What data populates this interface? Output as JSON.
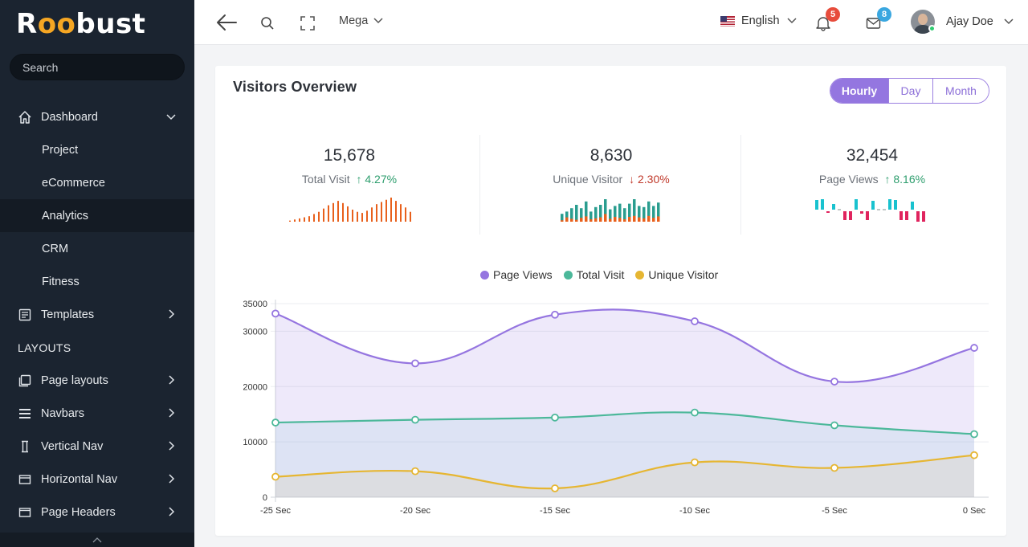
{
  "app": {
    "logo_prefix": "R",
    "logo_oo": "oo",
    "logo_suffix": "bust"
  },
  "sidebar": {
    "search_placeholder": "Search",
    "items": [
      {
        "label": "Dashboard",
        "icon": "home-icon",
        "type": "group-open"
      },
      {
        "label": "Project",
        "type": "sub"
      },
      {
        "label": "eCommerce",
        "type": "sub"
      },
      {
        "label": "Analytics",
        "type": "sub-active"
      },
      {
        "label": "CRM",
        "type": "sub"
      },
      {
        "label": "Fitness",
        "type": "sub"
      },
      {
        "label": "Templates",
        "icon": "template-icon",
        "type": "group"
      },
      {
        "label": "LAYOUTS",
        "type": "heading"
      },
      {
        "label": "Page layouts",
        "icon": "page-layout-icon",
        "type": "group"
      },
      {
        "label": "Navbars",
        "icon": "menu-lines-icon",
        "type": "group"
      },
      {
        "label": "Vertical Nav",
        "icon": "vertical-nav-icon",
        "type": "group"
      },
      {
        "label": "Horizontal Nav",
        "icon": "horizontal-nav-icon",
        "type": "group"
      },
      {
        "label": "Page Headers",
        "icon": "page-header-icon",
        "type": "group"
      }
    ]
  },
  "topbar": {
    "mega_label": "Mega",
    "language": "English",
    "notifications_count": "5",
    "messages_count": "8",
    "user_name": "Ajay Doe",
    "colors": {
      "notif_badge": "#e74c3c",
      "msg_badge": "#3aa7e0",
      "online": "#2ecc71"
    }
  },
  "card": {
    "title": "Visitors Overview",
    "range_options": [
      "Hourly",
      "Day",
      "Month"
    ],
    "selected_range": "Hourly",
    "accent": "#9476e0"
  },
  "stats": [
    {
      "value": "15,678",
      "label": "Total Visit",
      "arrow": "↑",
      "change": "4.27%",
      "direction": "up"
    },
    {
      "value": "8,630",
      "label": "Unique Visitor",
      "arrow": "↓",
      "change": "2.30%",
      "direction": "down"
    },
    {
      "value": "32,454",
      "label": "Page Views",
      "arrow": "↑",
      "change": "8.16%",
      "direction": "up"
    }
  ],
  "sparklines": {
    "total_visit": {
      "color": "#e8601c",
      "values": [
        1,
        2,
        3,
        4,
        5,
        7,
        9,
        12,
        15,
        17,
        19,
        17,
        14,
        11,
        9,
        8,
        10,
        13,
        16,
        18,
        20,
        22,
        19,
        16,
        13,
        9
      ]
    },
    "unique_visitor": {
      "colors": {
        "a": "#2a9d8f",
        "b": "#e8601c"
      },
      "bars": [
        [
          3,
          7
        ],
        [
          9,
          9
        ],
        [
          6,
          12
        ],
        [
          4,
          15
        ],
        [
          8,
          12
        ],
        [
          11,
          18
        ],
        [
          5,
          9
        ],
        [
          7,
          13
        ],
        [
          9,
          15
        ],
        [
          16,
          20
        ],
        [
          6,
          11
        ],
        [
          10,
          14
        ],
        [
          8,
          16
        ],
        [
          5,
          12
        ],
        [
          10,
          16
        ],
        [
          12,
          20
        ],
        [
          9,
          14
        ],
        [
          7,
          13
        ],
        [
          12,
          18
        ],
        [
          8,
          14
        ],
        [
          11,
          17
        ]
      ]
    },
    "page_views": {
      "colors": {
        "pos": "#19c2cf",
        "neg": "#e0245e",
        "zero": "#7f8c8d"
      },
      "values": [
        12,
        13,
        -2,
        7,
        0,
        -11,
        -11,
        13,
        -3,
        -11,
        11,
        0,
        0,
        13,
        12,
        -11,
        -11,
        10,
        -13,
        -13
      ]
    }
  },
  "chart_data": {
    "type": "area",
    "x": [
      "-25 Sec",
      "-20 Sec",
      "-15 Sec",
      "-10 Sec",
      "-5 Sec",
      "0 Sec"
    ],
    "ylim": [
      0,
      35000
    ],
    "yticks": [
      0,
      10000,
      20000,
      30000,
      35000
    ],
    "grid": true,
    "legend_position": "top",
    "series": [
      {
        "name": "Page Views",
        "color": "#9575e0",
        "fill": "rgba(149,117,224,0.16)",
        "values": [
          33200,
          24200,
          33000,
          31800,
          20900,
          27000
        ]
      },
      {
        "name": "Total Visit",
        "color": "#4cb89a",
        "fill": "rgba(134,200,220,0.16)",
        "values": [
          13500,
          14000,
          14400,
          15300,
          13000,
          11400
        ]
      },
      {
        "name": "Unique Visitor",
        "color": "#e6b632",
        "fill": "rgba(220,200,160,0.22)",
        "values": [
          3700,
          4700,
          1600,
          6300,
          5300,
          7600
        ]
      }
    ]
  }
}
